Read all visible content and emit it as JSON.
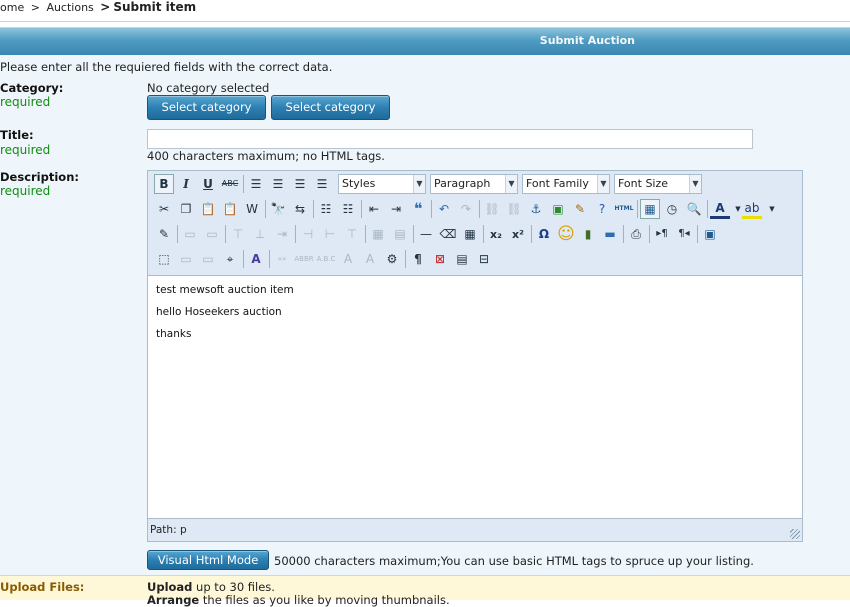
{
  "breadcrumb": {
    "home": "ome",
    "auctions": "Auctions",
    "current": "Submit item",
    "sep": ">"
  },
  "header": {
    "title": "Submit Auction"
  },
  "intro": "Please enter all the requiered fields with the correct data.",
  "category": {
    "label": "Category:",
    "required": "required",
    "status": "No category selected",
    "button1": "Select category",
    "button2": "Select category"
  },
  "title_field": {
    "label": "Title:",
    "required": "required",
    "value": "",
    "hint": "400 characters maximum; no HTML tags."
  },
  "description": {
    "label": "Description:",
    "required": "required",
    "dropdowns": {
      "styles": "Styles",
      "format": "Paragraph",
      "font_family": "Font Family",
      "font_size": "Font Size"
    },
    "content": [
      "test mewsoft auction item",
      "hello Hoseekers auction",
      "thanks"
    ],
    "path": "Path: p",
    "mode_button": "Visual Html Mode",
    "hint": "50000 characters maximum;You can use basic HTML tags to spruce up your listing."
  },
  "upload": {
    "label": "Upload Files:",
    "line1_bold": "Upload",
    "line1_rest": " up to 30 files.",
    "line2_bold": "Arrange",
    "line2_rest": " the files as you like by moving thumbnails."
  },
  "toolbar_glyphs": {
    "bold": "B",
    "italic": "I",
    "underline": "U",
    "strike": "ABC",
    "html": "HTML",
    "omega": "Ω",
    "smiley": "☺",
    "pilcrow": "¶",
    "subscript": "x₂",
    "superscript": "x²",
    "quote": "❝",
    "font_color": "A"
  }
}
